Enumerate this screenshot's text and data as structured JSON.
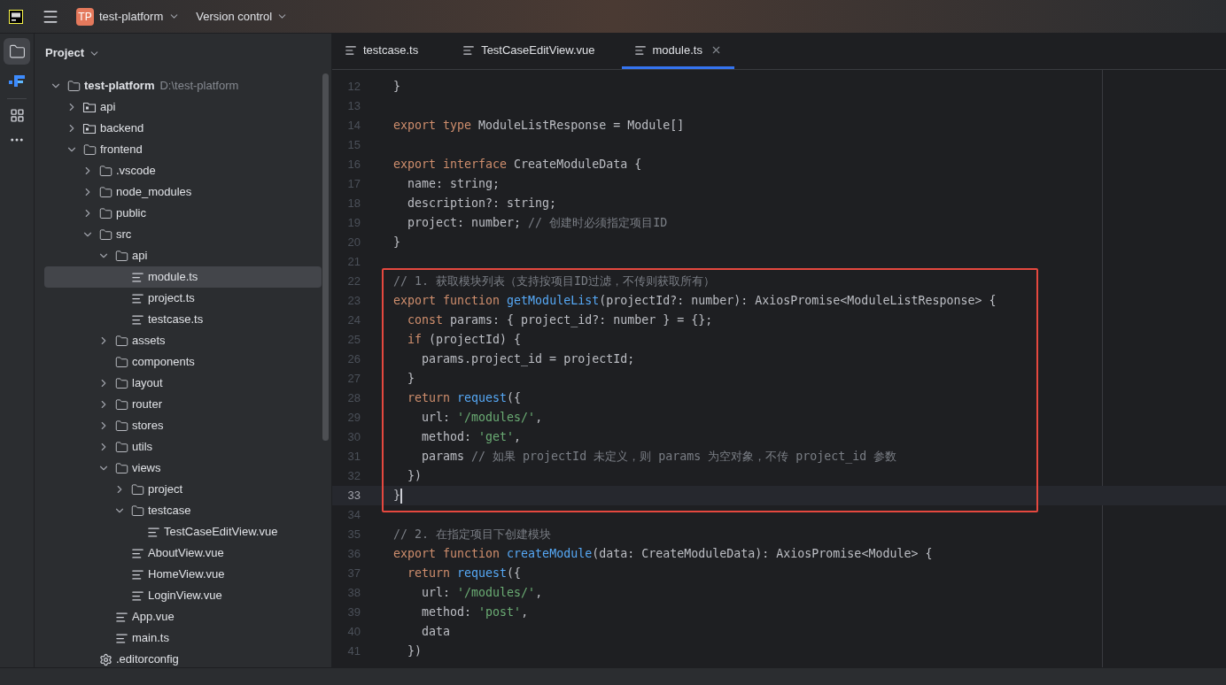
{
  "titlebar": {
    "project_badge": "TP",
    "project": "test-platform",
    "vcs": "Version control"
  },
  "project_panel": {
    "title": "Project",
    "tree": [
      {
        "label": "test-platform",
        "path": "D:\\test-platform",
        "kind": "root",
        "expanded": true,
        "selected": false,
        "children": [
          {
            "label": "api",
            "kind": "module",
            "expanded": false,
            "selected": false
          },
          {
            "label": "backend",
            "kind": "module",
            "expanded": false,
            "selected": false
          },
          {
            "label": "frontend",
            "kind": "folder",
            "expanded": true,
            "selected": false,
            "children": [
              {
                "label": ".vscode",
                "kind": "folder",
                "expanded": false,
                "selected": false
              },
              {
                "label": "node_modules",
                "kind": "folder",
                "expanded": false,
                "selected": false
              },
              {
                "label": "public",
                "kind": "folder",
                "expanded": false,
                "selected": false
              },
              {
                "label": "src",
                "kind": "folder",
                "expanded": true,
                "selected": false,
                "children": [
                  {
                    "label": "api",
                    "kind": "folder",
                    "expanded": true,
                    "selected": false,
                    "children": [
                      {
                        "label": "module.ts",
                        "kind": "file",
                        "selected": true
                      },
                      {
                        "label": "project.ts",
                        "kind": "file",
                        "selected": false
                      },
                      {
                        "label": "testcase.ts",
                        "kind": "file",
                        "selected": false
                      }
                    ]
                  },
                  {
                    "label": "assets",
                    "kind": "folder",
                    "expanded": false,
                    "selected": false
                  },
                  {
                    "label": "components",
                    "kind": "empty_folder",
                    "selected": false
                  },
                  {
                    "label": "layout",
                    "kind": "folder",
                    "expanded": false,
                    "selected": false
                  },
                  {
                    "label": "router",
                    "kind": "folder",
                    "expanded": false,
                    "selected": false
                  },
                  {
                    "label": "stores",
                    "kind": "folder",
                    "expanded": false,
                    "selected": false
                  },
                  {
                    "label": "utils",
                    "kind": "folder",
                    "expanded": false,
                    "selected": false
                  },
                  {
                    "label": "views",
                    "kind": "folder",
                    "expanded": true,
                    "selected": false,
                    "children": [
                      {
                        "label": "project",
                        "kind": "folder",
                        "expanded": false,
                        "selected": false
                      },
                      {
                        "label": "testcase",
                        "kind": "folder",
                        "expanded": true,
                        "selected": false,
                        "children": [
                          {
                            "label": "TestCaseEditView.vue",
                            "kind": "file",
                            "selected": false
                          }
                        ]
                      },
                      {
                        "label": "AboutView.vue",
                        "kind": "file",
                        "selected": false
                      },
                      {
                        "label": "HomeView.vue",
                        "kind": "file",
                        "selected": false
                      },
                      {
                        "label": "LoginView.vue",
                        "kind": "file",
                        "selected": false
                      }
                    ]
                  },
                  {
                    "label": "App.vue",
                    "kind": "file",
                    "selected": false
                  },
                  {
                    "label": "main.ts",
                    "kind": "file",
                    "selected": false
                  }
                ]
              },
              {
                "label": ".editorconfig",
                "kind": "config",
                "selected": false
              }
            ]
          }
        ]
      }
    ]
  },
  "tabs": [
    {
      "label": "testcase.ts",
      "selected": false
    },
    {
      "label": "TestCaseEditView.vue",
      "selected": false
    },
    {
      "label": "module.ts",
      "selected": true
    }
  ],
  "code": [
    {
      "kind": "line",
      "number": "12",
      "current": false,
      "tokens": [
        {
          "kind": "plain",
          "text": "}"
        }
      ]
    },
    {
      "kind": "line",
      "number": "13",
      "current": false
    },
    {
      "kind": "line",
      "number": "14",
      "current": false,
      "tokens": [
        {
          "kind": "keyword",
          "text": "export type "
        },
        {
          "kind": "plain",
          "text": "ModuleListResponse = Module[]"
        }
      ]
    },
    {
      "kind": "line",
      "number": "15",
      "current": false
    },
    {
      "kind": "line",
      "number": "16",
      "current": false,
      "tokens": [
        {
          "kind": "keyword",
          "text": "export interface "
        },
        {
          "kind": "plain",
          "text": "CreateModuleData {"
        }
      ]
    },
    {
      "kind": "line",
      "number": "17",
      "current": false,
      "tokens": [
        {
          "kind": "plain",
          "text": "  name: string;"
        }
      ]
    },
    {
      "kind": "line",
      "number": "18",
      "current": false,
      "tokens": [
        {
          "kind": "plain",
          "text": "  description?: string;"
        }
      ]
    },
    {
      "kind": "line",
      "number": "19",
      "current": false,
      "tokens": [
        {
          "kind": "plain",
          "text": "  project: number; "
        },
        {
          "kind": "comment",
          "text": "// 创建时必须指定项目ID"
        }
      ]
    },
    {
      "kind": "line",
      "number": "20",
      "current": false,
      "tokens": [
        {
          "kind": "plain",
          "text": "}"
        }
      ]
    },
    {
      "kind": "line",
      "number": "21",
      "current": false
    },
    {
      "kind": "frame",
      "lines": [
        {
          "number": "22",
          "current": false,
          "tokens": [
            {
              "kind": "comment",
              "text": "// 1. 获取模块列表（支持按项目ID过滤，不传则获取所有）"
            }
          ]
        },
        {
          "number": "23",
          "current": false,
          "tokens": [
            {
              "kind": "keyword",
              "text": "export function "
            },
            {
              "kind": "function",
              "text": "getModuleList"
            },
            {
              "kind": "plain",
              "text": "(projectId?: number): AxiosPromise<ModuleListResponse> {"
            }
          ]
        },
        {
          "number": "24",
          "current": false,
          "tokens": [
            {
              "kind": "keyword",
              "text": "  const "
            },
            {
              "kind": "plain",
              "text": "params: { project_id?: number } = {};"
            }
          ]
        },
        {
          "number": "25",
          "current": false,
          "tokens": [
            {
              "kind": "keyword",
              "text": "  if "
            },
            {
              "kind": "plain",
              "text": "(projectId) {"
            }
          ]
        },
        {
          "number": "26",
          "current": false,
          "tokens": [
            {
              "kind": "plain",
              "text": "    params.project_id = projectId;"
            }
          ]
        },
        {
          "number": "27",
          "current": false,
          "tokens": [
            {
              "kind": "plain",
              "text": "  }"
            }
          ]
        },
        {
          "number": "28",
          "current": false,
          "tokens": [
            {
              "kind": "keyword",
              "text": "  return "
            },
            {
              "kind": "function",
              "text": "request"
            },
            {
              "kind": "plain",
              "text": "({"
            }
          ]
        },
        {
          "number": "29",
          "current": false,
          "tokens": [
            {
              "kind": "plain",
              "text": "    url: "
            },
            {
              "kind": "string",
              "text": "'/modules/'"
            },
            {
              "kind": "plain",
              "text": ","
            }
          ]
        },
        {
          "number": "30",
          "current": false,
          "tokens": [
            {
              "kind": "plain",
              "text": "    method: "
            },
            {
              "kind": "string",
              "text": "'get'"
            },
            {
              "kind": "plain",
              "text": ","
            }
          ]
        },
        {
          "number": "31",
          "current": false,
          "tokens": [
            {
              "kind": "plain",
              "text": "    params "
            },
            {
              "kind": "comment",
              "text": "// 如果 projectId 未定义，则 params 为空对象，不传 project_id 参数"
            }
          ]
        },
        {
          "number": "32",
          "current": false,
          "tokens": [
            {
              "kind": "plain",
              "text": "  })"
            }
          ]
        },
        {
          "number": "33",
          "current": true,
          "tokens": [
            {
              "kind": "plain",
              "text": "}"
            }
          ]
        }
      ]
    },
    {
      "kind": "line",
      "number": "34",
      "current": false
    },
    {
      "kind": "line",
      "number": "35",
      "current": false,
      "tokens": [
        {
          "kind": "comment",
          "text": "// 2. 在指定项目下创建模块"
        }
      ]
    },
    {
      "kind": "line",
      "number": "36",
      "current": false,
      "tokens": [
        {
          "kind": "keyword",
          "text": "export function "
        },
        {
          "kind": "function",
          "text": "createModule"
        },
        {
          "kind": "plain",
          "text": "(data: CreateModuleData): AxiosPromise<Module> {"
        }
      ]
    },
    {
      "kind": "line",
      "number": "37",
      "current": false,
      "tokens": [
        {
          "kind": "keyword",
          "text": "  return "
        },
        {
          "kind": "function",
          "text": "request"
        },
        {
          "kind": "plain",
          "text": "({"
        }
      ]
    },
    {
      "kind": "line",
      "number": "38",
      "current": false,
      "tokens": [
        {
          "kind": "plain",
          "text": "    url: "
        },
        {
          "kind": "string",
          "text": "'/modules/'"
        },
        {
          "kind": "plain",
          "text": ","
        }
      ]
    },
    {
      "kind": "line",
      "number": "39",
      "current": false,
      "tokens": [
        {
          "kind": "plain",
          "text": "    method: "
        },
        {
          "kind": "string",
          "text": "'post'"
        },
        {
          "kind": "plain",
          "text": ","
        }
      ]
    },
    {
      "kind": "line",
      "number": "40",
      "current": false,
      "tokens": [
        {
          "kind": "plain",
          "text": "    data"
        }
      ]
    },
    {
      "kind": "line",
      "number": "41",
      "current": false,
      "tokens": [
        {
          "kind": "plain",
          "text": "  })"
        }
      ]
    }
  ]
}
